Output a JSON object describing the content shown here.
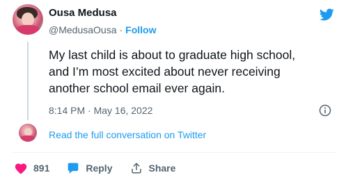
{
  "author": {
    "name": "Ousa Medusa",
    "handle": "@MedusaOusa",
    "separator": "·",
    "follow_label": "Follow"
  },
  "tweet": {
    "lines": [
      "My last child is about to graduate high school,",
      "and I’m most excited about never receiving",
      "another school email ever again."
    ],
    "timestamp": "8:14 PM · May 16, 2022"
  },
  "read_conversation_label": "Read the full conversation on Twitter",
  "actions": {
    "like_count": "891",
    "reply_label": "Reply",
    "share_label": "Share"
  },
  "colors": {
    "accent": "#1d9bf0",
    "like": "#f91880",
    "secondary_text": "#536471"
  },
  "icons": [
    "twitter-logo-icon",
    "info-icon",
    "heart-icon",
    "reply-bubble-icon",
    "share-upload-icon"
  ]
}
